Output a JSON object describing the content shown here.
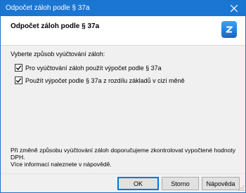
{
  "window": {
    "title": "Odpočet záloh podle § 37a"
  },
  "header": {
    "heading": "Odpočet záloh podle § 37a",
    "logo_icon": "app-logo-icon"
  },
  "content": {
    "prompt": "Vyberte způsob vyúčtování záloh:",
    "options": [
      {
        "label": "Pro vyúčtování záloh použít výpočet podle § 37a",
        "checked": true
      },
      {
        "label": "Použít výpočet podle § 37a z rozdílu základů v cizí měně",
        "checked": true
      }
    ],
    "info_lines": [
      "Při změně způsobu vyúčtování záloh doporučujeme zkontrolovat vypočtené hodnoty DPH.",
      "Více informací naleznete v nápovědě."
    ]
  },
  "footer": {
    "ok_label": "OK",
    "cancel_label": "Storno",
    "help_label": "Nápověda"
  },
  "colors": {
    "titlebar": "#1a76d2",
    "accent": "#0078d7"
  }
}
